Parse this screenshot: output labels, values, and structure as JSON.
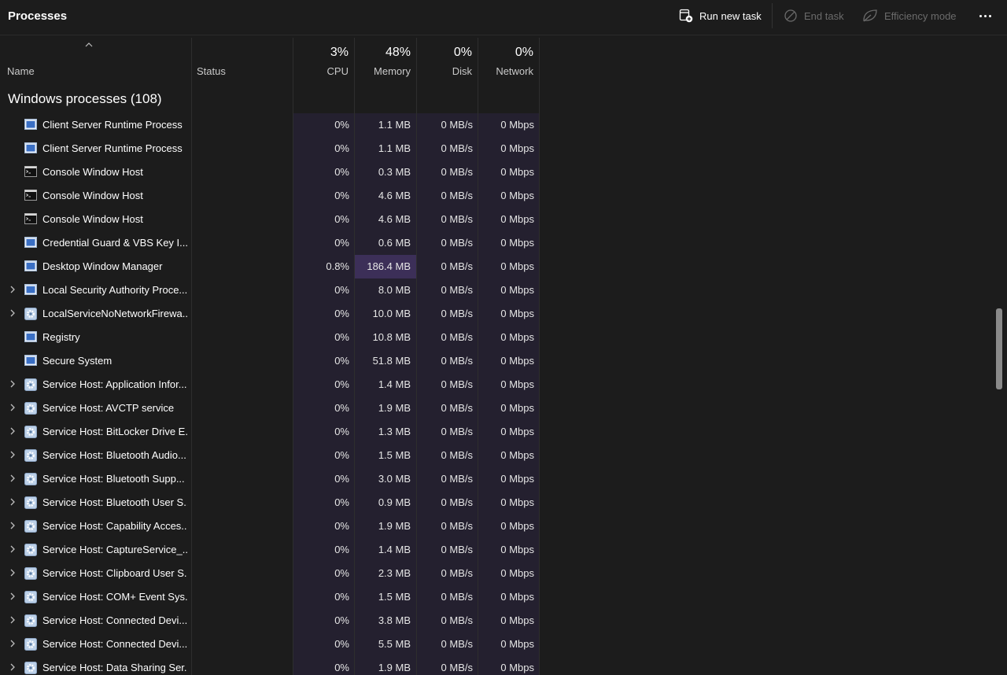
{
  "page_title": "Processes",
  "toolbar": {
    "run_new_task": "Run new task",
    "end_task": "End task",
    "efficiency_mode": "Efficiency mode"
  },
  "columns": {
    "name": "Name",
    "status": "Status",
    "cpu": {
      "pct": "3%",
      "label": "CPU"
    },
    "memory": {
      "pct": "48%",
      "label": "Memory"
    },
    "disk": {
      "pct": "0%",
      "label": "Disk"
    },
    "network": {
      "pct": "0%",
      "label": "Network"
    }
  },
  "group": {
    "title": "Windows processes (108)"
  },
  "rows": [
    {
      "name": "Client Server Runtime Process",
      "icon": "app-window-icon",
      "expandable": false,
      "cpu": "0%",
      "memory": "1.1 MB",
      "disk": "0 MB/s",
      "network": "0 Mbps"
    },
    {
      "name": "Client Server Runtime Process",
      "icon": "app-window-icon",
      "expandable": false,
      "cpu": "0%",
      "memory": "1.1 MB",
      "disk": "0 MB/s",
      "network": "0 Mbps"
    },
    {
      "name": "Console Window Host",
      "icon": "console-icon",
      "expandable": false,
      "cpu": "0%",
      "memory": "0.3 MB",
      "disk": "0 MB/s",
      "network": "0 Mbps"
    },
    {
      "name": "Console Window Host",
      "icon": "console-icon",
      "expandable": false,
      "cpu": "0%",
      "memory": "4.6 MB",
      "disk": "0 MB/s",
      "network": "0 Mbps"
    },
    {
      "name": "Console Window Host",
      "icon": "console-icon",
      "expandable": false,
      "cpu": "0%",
      "memory": "4.6 MB",
      "disk": "0 MB/s",
      "network": "0 Mbps"
    },
    {
      "name": "Credential Guard & VBS Key I...",
      "icon": "app-window-icon",
      "expandable": false,
      "cpu": "0%",
      "memory": "0.6 MB",
      "disk": "0 MB/s",
      "network": "0 Mbps"
    },
    {
      "name": "Desktop Window Manager",
      "icon": "app-window-icon",
      "expandable": false,
      "cpu": "0.8%",
      "memory": "186.4 MB",
      "disk": "0 MB/s",
      "network": "0 Mbps",
      "memory_highlight": true
    },
    {
      "name": "Local Security Authority Proce...",
      "icon": "app-window-icon",
      "expandable": true,
      "cpu": "0%",
      "memory": "8.0 MB",
      "disk": "0 MB/s",
      "network": "0 Mbps"
    },
    {
      "name": "LocalServiceNoNetworkFirewa...",
      "icon": "gear-icon",
      "expandable": true,
      "cpu": "0%",
      "memory": "10.0 MB",
      "disk": "0 MB/s",
      "network": "0 Mbps"
    },
    {
      "name": "Registry",
      "icon": "app-window-icon",
      "expandable": false,
      "cpu": "0%",
      "memory": "10.8 MB",
      "disk": "0 MB/s",
      "network": "0 Mbps"
    },
    {
      "name": "Secure System",
      "icon": "app-window-icon",
      "expandable": false,
      "cpu": "0%",
      "memory": "51.8 MB",
      "disk": "0 MB/s",
      "network": "0 Mbps"
    },
    {
      "name": "Service Host: Application Infor...",
      "icon": "gear-icon",
      "expandable": true,
      "cpu": "0%",
      "memory": "1.4 MB",
      "disk": "0 MB/s",
      "network": "0 Mbps"
    },
    {
      "name": "Service Host: AVCTP service",
      "icon": "gear-icon",
      "expandable": true,
      "cpu": "0%",
      "memory": "1.9 MB",
      "disk": "0 MB/s",
      "network": "0 Mbps"
    },
    {
      "name": "Service Host: BitLocker Drive E...",
      "icon": "gear-icon",
      "expandable": true,
      "cpu": "0%",
      "memory": "1.3 MB",
      "disk": "0 MB/s",
      "network": "0 Mbps"
    },
    {
      "name": "Service Host: Bluetooth Audio...",
      "icon": "gear-icon",
      "expandable": true,
      "cpu": "0%",
      "memory": "1.5 MB",
      "disk": "0 MB/s",
      "network": "0 Mbps"
    },
    {
      "name": "Service Host: Bluetooth Supp...",
      "icon": "gear-icon",
      "expandable": true,
      "cpu": "0%",
      "memory": "3.0 MB",
      "disk": "0 MB/s",
      "network": "0 Mbps"
    },
    {
      "name": "Service Host: Bluetooth User S...",
      "icon": "gear-icon",
      "expandable": true,
      "cpu": "0%",
      "memory": "0.9 MB",
      "disk": "0 MB/s",
      "network": "0 Mbps"
    },
    {
      "name": "Service Host: Capability Acces...",
      "icon": "gear-icon",
      "expandable": true,
      "cpu": "0%",
      "memory": "1.9 MB",
      "disk": "0 MB/s",
      "network": "0 Mbps"
    },
    {
      "name": "Service Host: CaptureService_...",
      "icon": "gear-icon",
      "expandable": true,
      "cpu": "0%",
      "memory": "1.4 MB",
      "disk": "0 MB/s",
      "network": "0 Mbps"
    },
    {
      "name": "Service Host: Clipboard User S...",
      "icon": "gear-icon",
      "expandable": true,
      "cpu": "0%",
      "memory": "2.3 MB",
      "disk": "0 MB/s",
      "network": "0 Mbps"
    },
    {
      "name": "Service Host: COM+ Event Sys...",
      "icon": "gear-icon",
      "expandable": true,
      "cpu": "0%",
      "memory": "1.5 MB",
      "disk": "0 MB/s",
      "network": "0 Mbps"
    },
    {
      "name": "Service Host: Connected Devi...",
      "icon": "gear-icon",
      "expandable": true,
      "cpu": "0%",
      "memory": "3.8 MB",
      "disk": "0 MB/s",
      "network": "0 Mbps"
    },
    {
      "name": "Service Host: Connected Devi...",
      "icon": "gear-icon",
      "expandable": true,
      "cpu": "0%",
      "memory": "5.5 MB",
      "disk": "0 MB/s",
      "network": "0 Mbps"
    },
    {
      "name": "Service Host: Data Sharing Ser...",
      "icon": "gear-icon",
      "expandable": true,
      "cpu": "0%",
      "memory": "1.9 MB",
      "disk": "0 MB/s",
      "network": "0 Mbps"
    }
  ]
}
